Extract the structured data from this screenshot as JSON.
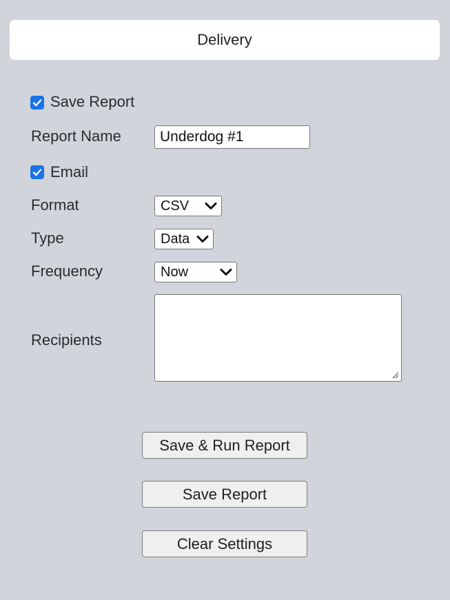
{
  "header": {
    "title": "Delivery"
  },
  "form": {
    "save_report": {
      "label": "Save Report",
      "checked": true
    },
    "report_name": {
      "label": "Report Name",
      "value": "Underdog #1"
    },
    "email": {
      "label": "Email",
      "checked": true
    },
    "format": {
      "label": "Format",
      "selected": "CSV"
    },
    "type": {
      "label": "Type",
      "selected": "Data"
    },
    "frequency": {
      "label": "Frequency",
      "selected": "Now"
    },
    "recipients": {
      "label": "Recipients",
      "value": ""
    }
  },
  "actions": {
    "save_and_run": "Save & Run Report",
    "save_report": "Save Report",
    "clear_settings": "Clear Settings"
  },
  "icons": {
    "checkbox": "checkmark-icon",
    "select": "chevron-down-icon",
    "textarea": "resize-handle-icon"
  },
  "colors": {
    "background": "#d1d5db",
    "checkbox_accent": "#1a73e8",
    "button_bg": "#efefef",
    "panel_bg": "#ffffff"
  }
}
